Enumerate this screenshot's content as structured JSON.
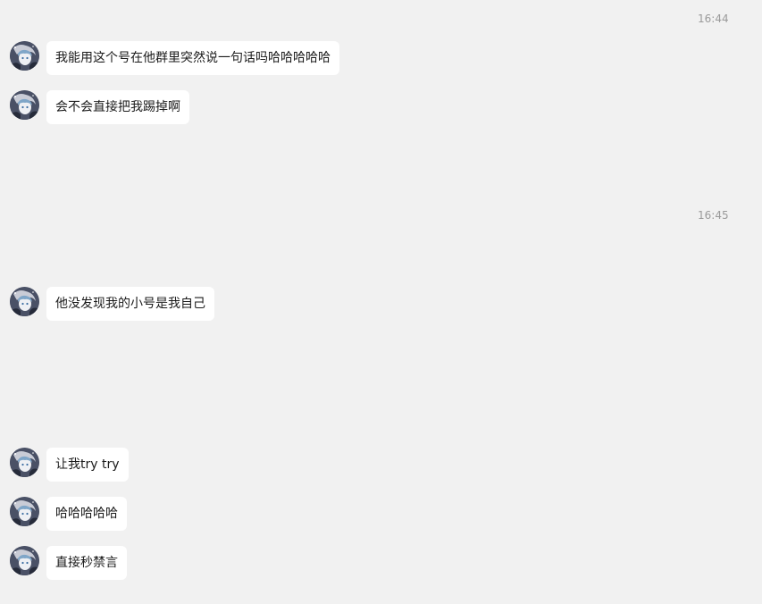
{
  "chat": {
    "timestamps": [
      "16:44",
      "16:45"
    ],
    "messages": [
      {
        "text": "我能用这个号在他群里突然说一句话吗哈哈哈哈哈"
      },
      {
        "text": "会不会直接把我踢掉啊"
      },
      {
        "text": "他没发现我的小号是我自己"
      },
      {
        "text": "让我try try"
      },
      {
        "text": "哈哈哈哈哈"
      },
      {
        "text": "直接秒禁言"
      }
    ],
    "avatar_icon": "user-avatar-anime"
  }
}
